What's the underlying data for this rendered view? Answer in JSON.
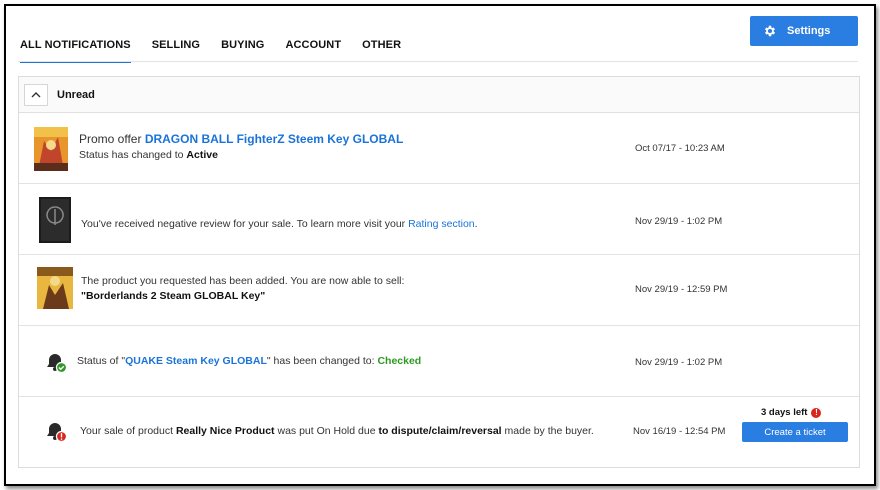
{
  "tabs": [
    {
      "label": "ALL NOTIFICATIONS"
    },
    {
      "label": "SELLING"
    },
    {
      "label": "BUYING"
    },
    {
      "label": "ACCOUNT"
    },
    {
      "label": "OTHER"
    }
  ],
  "settings": {
    "label": "Settings",
    "icon": "gear-icon"
  },
  "section": {
    "title": "Unread",
    "icon": "chevron-up-icon"
  },
  "notifications": [
    {
      "prefix": "Promo offer ",
      "link": "DRAGON BALL FighterZ Steem Key GLOBAL",
      "line2_prefix": "Status has changed to ",
      "line2_bold": "Active",
      "date": "Oct 07/17 - 10:23 AM",
      "thumb": "dragon-ball-cover"
    },
    {
      "text": "You've received negative review for your sale. To learn more visit your ",
      "link": "Rating section",
      "suffix": ".",
      "date": "Nov 29/19 - 1:02 PM",
      "thumb": "quake-cover"
    },
    {
      "line1": "The product you requested has been added. You are now able to sell:",
      "line2_bold": "\"Borderlands 2 Steam GLOBAL Key\"",
      "date": "Nov 29/19 - 12:59 PM",
      "thumb": "borderlands-cover"
    },
    {
      "prefix": "Status of \"",
      "link": "QUAKE Steam Key GLOBAL",
      "mid": "\" has been changed to: ",
      "status": "Checked",
      "date": "Nov 29/19 - 1:02 PM",
      "icon": "bell-check-icon"
    },
    {
      "t1": "Your sale of product ",
      "b1": "Really Nice Product",
      "t2": " was put On Hold due ",
      "b2": "to dispute/claim/reversal",
      "t3": " made by the buyer.",
      "date": "Nov 16/19 - 12:54 PM",
      "days_left": "3 days left",
      "days_icon": "!",
      "button": "Create a ticket",
      "icon": "bell-alert-icon"
    }
  ],
  "colors": {
    "accent": "#2a7de1",
    "link": "#1a73d9",
    "success": "#2e9a24",
    "alert": "#d9261c"
  }
}
